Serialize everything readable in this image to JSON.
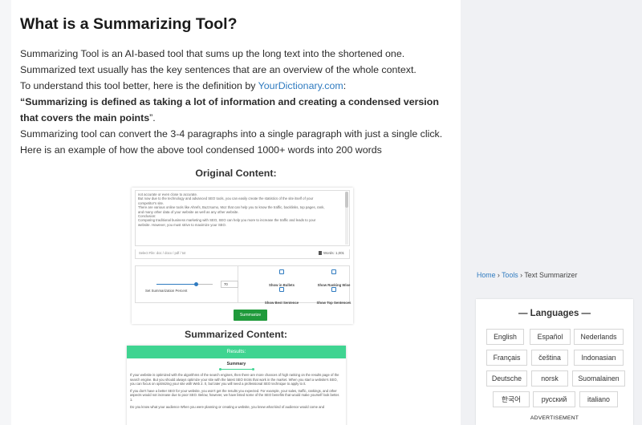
{
  "article": {
    "title": "What is a Summarizing Tool?",
    "p1": "Summarizing Tool is an AI-based tool that sums up the long text into the shortened one. Summarized text usually has the key sentences that are an overview of the whole context.",
    "p2_prefix": "To understand this tool better, here is the definition by ",
    "p2_link": "YourDictionary.com",
    "p2_suffix": ":",
    "quote_open": "“",
    "quote": "Summarizing is defined as taking a lot of information and creating a condensed version that covers the main points",
    "quote_close": "”.",
    "p4": "Summarizing tool can convert the 3-4 paragraphs into a single paragraph with just a single click.",
    "p5": "Here is an example of how the above tool condensed 1000+ words into 200 words",
    "original_heading": "Original Content:",
    "summarized_heading": "Summarized Content:"
  },
  "tool": {
    "text_lines": [
      "not accurate or even close to accurate.",
      "But now due to the technology and advanced SEO tools, you can easily create the statistics of the site itself of your",
      "competitor's site.",
      "There are various online tools like Ahrefs, Buzzsumo, Moz that can help you to know the traffic, backlinks, top pages, rank,",
      "and many other data of your website as well as any other website.",
      "Conclusion:",
      "Comparing traditional business marketing with SEO, SEO can help you more to increase the traffic and leads to your",
      "website. However, you must strive to maximize your SEO."
    ],
    "select_file": "Select File: doc / docx / pdf / txt",
    "words": "Words: 1,001",
    "percent_value": "70",
    "percent_label": "Set Summarization Percent",
    "slider_fraction": 0.7,
    "options": [
      "Show in Bullets",
      "Show Ranking Wise",
      "Show Best Sentence",
      "Show Top Sentences"
    ],
    "button": "Summarize"
  },
  "results": {
    "header": "Results:",
    "summary_label": "Summary",
    "paragraphs": [
      "If your website is optimized with the algorithms of the search engines, then there are more chances of high ranking on the results page of the search engine. But you should always optimize your site with the latest SEO tricks that work in the market. When you start a website's SEO, you can focus on optimizing your site with Web 2. 0, but later you will need a professional SEO technique to apply to it.",
      "If you don't have a better SEO for your website, you won't get the results you expected. For example, your sales, traffic, rankings, and other aspects would not increase due to poor SEO. Below, however, we have listed some of the SEO benefits that would make yourself look better. 1.",
      "Do you know what your audience When you were planning or creating a website, you knew what kind of audience would come and"
    ]
  },
  "sidebar": {
    "breadcrumb": {
      "home": "Home",
      "sep": "›",
      "tools": "Tools",
      "current": "Text Summarizer"
    },
    "languages_title": "— Languages —",
    "languages": [
      "English",
      "Español",
      "Nederlands",
      "Français",
      "čeština",
      "Indonasian",
      "Deutsche",
      "norsk",
      "Suomalainen",
      "한국어",
      "русский",
      "italiano"
    ],
    "advertisement": "ADVERTISEMENT"
  },
  "colors": {
    "link": "#2f7bc0",
    "accent_green": "#3fd491",
    "button_green": "#1f9a3b"
  }
}
